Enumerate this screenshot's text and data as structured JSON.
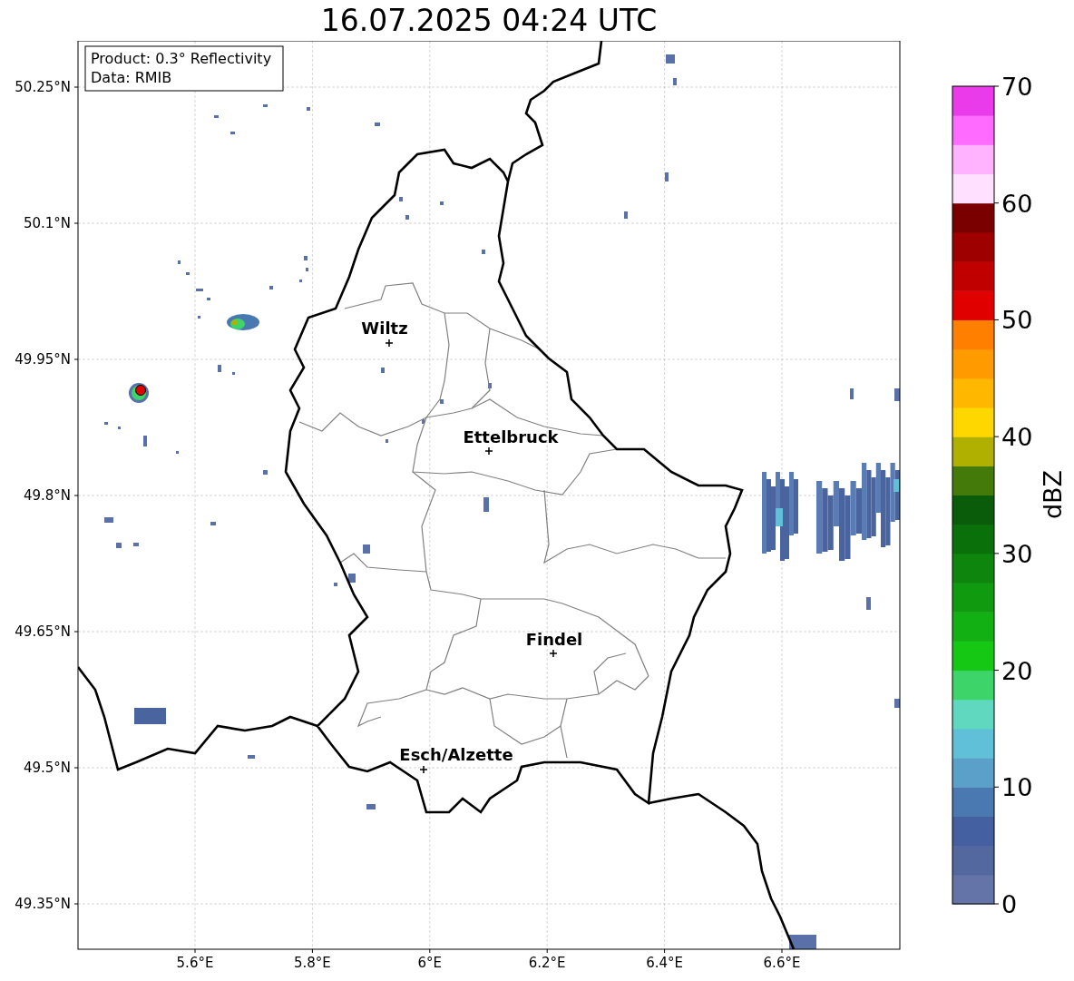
{
  "title": "16.07.2025 04:24 UTC",
  "info_box": [
    "Product: 0.3° Reflectivity",
    "Data: RMIB"
  ],
  "map": {
    "xticks": [
      "5.6°E",
      "5.8°E",
      "6°E",
      "6.2°E",
      "6.4°E",
      "6.6°E"
    ],
    "yticks": [
      "50.25°N",
      "50.1°N",
      "49.95°N",
      "49.8°N",
      "49.65°N",
      "49.5°N",
      "49.35°N"
    ],
    "cities": [
      {
        "name": "Wiltz"
      },
      {
        "name": "Ettelbruck"
      },
      {
        "name": "Findel"
      },
      {
        "name": "Esch/Alzette"
      }
    ]
  },
  "colorbar": {
    "label": "dBZ",
    "ticks": [
      "70",
      "60",
      "50",
      "40",
      "30",
      "20",
      "10",
      "0"
    ],
    "bins": [
      {
        "color": "#6474a8"
      },
      {
        "color": "#5468a0"
      },
      {
        "color": "#4460a0"
      },
      {
        "color": "#4a78b0"
      },
      {
        "color": "#5aa0c8"
      },
      {
        "color": "#60c0d8"
      },
      {
        "color": "#60d8c0"
      },
      {
        "color": "#3dd46a"
      },
      {
        "color": "#14c814"
      },
      {
        "color": "#12b012"
      },
      {
        "color": "#109a10"
      },
      {
        "color": "#0e860e"
      },
      {
        "color": "#0a700a"
      },
      {
        "color": "#0a5c0a"
      },
      {
        "color": "#447a0a"
      },
      {
        "color": "#b0b000"
      },
      {
        "color": "#ffd700"
      },
      {
        "color": "#ffb700"
      },
      {
        "color": "#ff9a00"
      },
      {
        "color": "#ff7f00"
      },
      {
        "color": "#e00000"
      },
      {
        "color": "#c00000"
      },
      {
        "color": "#9e0000"
      },
      {
        "color": "#7a0000"
      },
      {
        "color": "#ffe0ff"
      },
      {
        "color": "#ffb3ff"
      },
      {
        "color": "#ff6bff"
      },
      {
        "color": "#e93be9"
      }
    ]
  }
}
